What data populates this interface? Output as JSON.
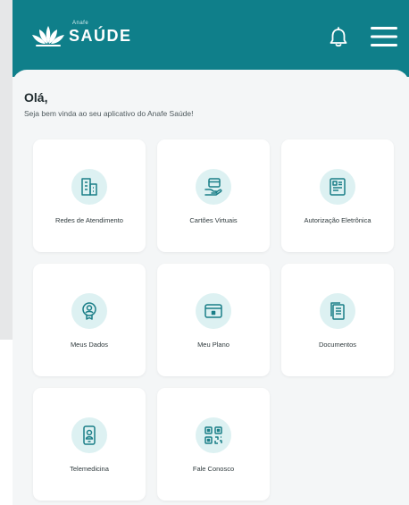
{
  "colors": {
    "header_bg": "#0f7f8a",
    "screen_bg": "#f4f6f7",
    "tile_bg": "#ffffff",
    "icon_bg": "#ddf1f2",
    "icon_color": "#1b7f88"
  },
  "header": {
    "logo_small_text": "Anafe",
    "logo_text": "SAÚDE",
    "icons": [
      "lotus-logo-icon",
      "bell-icon",
      "hamburger-menu-icon"
    ]
  },
  "greeting": {
    "title": "Olá,",
    "subtitle": "Seja bem vinda ao seu aplicativo do Anafe Saúde!"
  },
  "tiles": [
    {
      "label": "Redes de Atendimento",
      "icon": "buildings-icon"
    },
    {
      "label": "Cartões Virtuais",
      "icon": "card-hand-icon"
    },
    {
      "label": "Autorização Eletrônica",
      "icon": "document-authorization-icon"
    },
    {
      "label": "Meus Dados",
      "icon": "user-badge-icon"
    },
    {
      "label": "Meu Plano",
      "icon": "plan-card-icon"
    },
    {
      "label": "Documentos",
      "icon": "documents-icon"
    },
    {
      "label": "Telemedicina",
      "icon": "phone-doctor-icon"
    },
    {
      "label": "Fale Conosco",
      "icon": "qr-chat-icon"
    }
  ]
}
